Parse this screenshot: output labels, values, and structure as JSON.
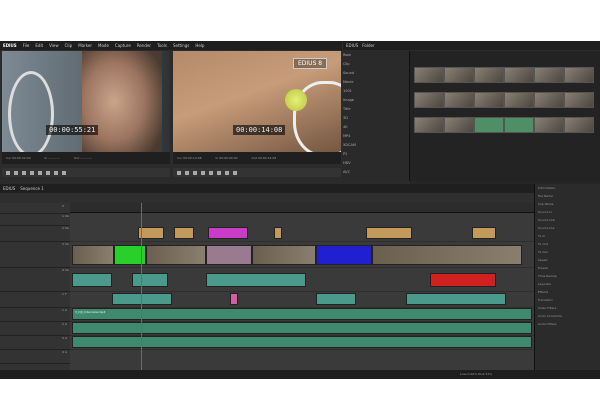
{
  "app": {
    "brand": "EDIUS",
    "menu": [
      "File",
      "Edit",
      "View",
      "Clip",
      "Marker",
      "Mode",
      "Capture",
      "Render",
      "Tools",
      "Settings",
      "Help"
    ]
  },
  "player": {
    "timecode": "00:00:55:21",
    "labels": [
      "Cur 00:00:52:09",
      "In --:--:--:--",
      "Out --:--:--:--",
      "Dur --:--:--:--"
    ]
  },
  "recorder": {
    "timecode": "00:00:14:08",
    "logo": "EDIUS 8",
    "labels": [
      "Cur 00:00:14:08",
      "In 00:00:00:00",
      "Out 00:00:14:08",
      "Dur 00:00:14:08"
    ]
  },
  "bin": {
    "title": "EDIUS",
    "tabs": [
      "Folder"
    ],
    "tree": [
      "Root",
      "Clip",
      "Sound",
      "Movie",
      "1001",
      "Image",
      "Title",
      "3D",
      "4K",
      "MP4",
      "XDCAM",
      "P2",
      "HDV",
      "AVC",
      "Sync"
    ]
  },
  "timeline": {
    "title": "EDIUS",
    "sequence": "Sequence 1",
    "tracks": [
      "V",
      "1 VA",
      "2 VA",
      "3 VA",
      "4 VA",
      "1 T",
      "1 A",
      "2 A",
      "3 A",
      "4 A"
    ],
    "audio_clip_label": "3_DJI_Interview.mp4"
  },
  "side_panel": {
    "title": "Information",
    "rows": [
      "File Name",
      "Clip Name",
      "Source In",
      "Source Out",
      "Source Dur",
      "TL In",
      "TL Out",
      "TL Dur",
      "Speed",
      "Freeze",
      "Time Remap",
      "Layouter",
      "Effects"
    ],
    "tree": [
      "Transition",
      "Video Filters",
      "Color Correction",
      "Audio Filters"
    ]
  },
  "status": {
    "text": "Loss 0.00% Disk 52%"
  }
}
